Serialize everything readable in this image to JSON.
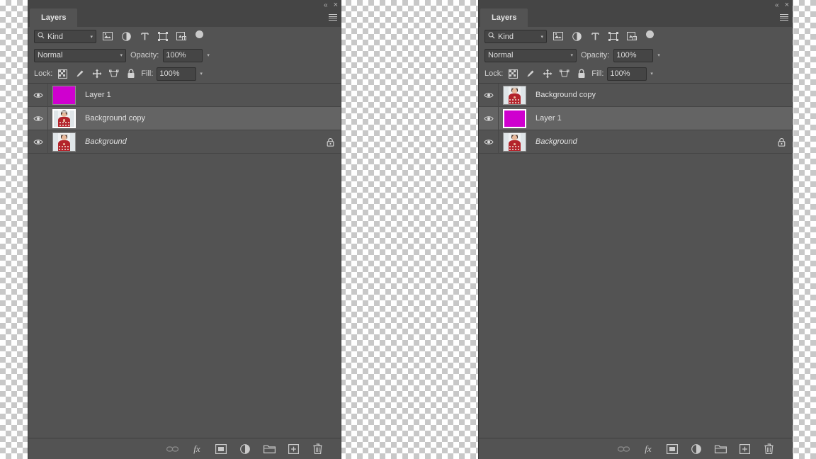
{
  "app": {
    "panel_title": "Layers",
    "accent_magenta": "#cf00cf",
    "panel_bg": "#535353",
    "selected_row_bg": "#646464"
  },
  "window_controls": {
    "collapse_label": "«",
    "close_label": "×",
    "menu_name": "panel-menu"
  },
  "filter_bar": {
    "kind_label": "Kind",
    "search_icon": "search-icon",
    "icons": [
      {
        "name": "filter-pixel-layers-icon",
        "title": "Pixel layers"
      },
      {
        "name": "filter-adjustment-layers-icon",
        "title": "Adjustment layers"
      },
      {
        "name": "filter-type-layers-icon",
        "title": "Type layers"
      },
      {
        "name": "filter-shape-layers-icon",
        "title": "Shape layers"
      },
      {
        "name": "filter-smart-object-icon",
        "title": "Smart objects"
      }
    ],
    "toggle_name": "filter-enable-toggle"
  },
  "blend_bar": {
    "blend_mode": "Normal",
    "opacity_label": "Opacity:",
    "opacity_value": "100%"
  },
  "lock_bar": {
    "lock_label": "Lock:",
    "fill_label": "Fill:",
    "fill_value": "100%",
    "icons": [
      {
        "name": "lock-transparent-pixels-icon"
      },
      {
        "name": "lock-image-pixels-icon"
      },
      {
        "name": "lock-position-icon"
      },
      {
        "name": "lock-artboard-nesting-icon"
      },
      {
        "name": "lock-all-icon"
      }
    ]
  },
  "panels": [
    {
      "id": "left",
      "layers": [
        {
          "name": "Layer 1",
          "thumb": "magenta",
          "visible": true,
          "selected": false,
          "locked": false,
          "italic": false
        },
        {
          "name": "Background copy",
          "thumb": "portrait",
          "visible": true,
          "selected": true,
          "locked": false,
          "italic": false
        },
        {
          "name": "Background",
          "thumb": "portrait",
          "visible": true,
          "selected": false,
          "locked": true,
          "italic": true
        }
      ]
    },
    {
      "id": "right",
      "layers": [
        {
          "name": "Background copy",
          "thumb": "portrait",
          "visible": true,
          "selected": false,
          "locked": false,
          "italic": false
        },
        {
          "name": "Layer 1",
          "thumb": "magenta",
          "visible": true,
          "selected": true,
          "locked": false,
          "italic": false
        },
        {
          "name": "Background",
          "thumb": "portrait",
          "visible": true,
          "selected": false,
          "locked": true,
          "italic": true
        }
      ]
    }
  ],
  "bottom_bar": {
    "buttons": [
      {
        "name": "link-layers-button",
        "glyph": "link",
        "enabled": false
      },
      {
        "name": "layer-style-button",
        "glyph": "fx",
        "label": "fx",
        "enabled": true
      },
      {
        "name": "add-layer-mask-button",
        "glyph": "mask",
        "enabled": true
      },
      {
        "name": "new-adjustment-layer-button",
        "glyph": "adjustment",
        "enabled": true
      },
      {
        "name": "new-group-button",
        "glyph": "folder",
        "enabled": true
      },
      {
        "name": "new-layer-button",
        "glyph": "new-layer",
        "enabled": true
      },
      {
        "name": "delete-layer-button",
        "glyph": "trash",
        "enabled": true
      }
    ]
  }
}
